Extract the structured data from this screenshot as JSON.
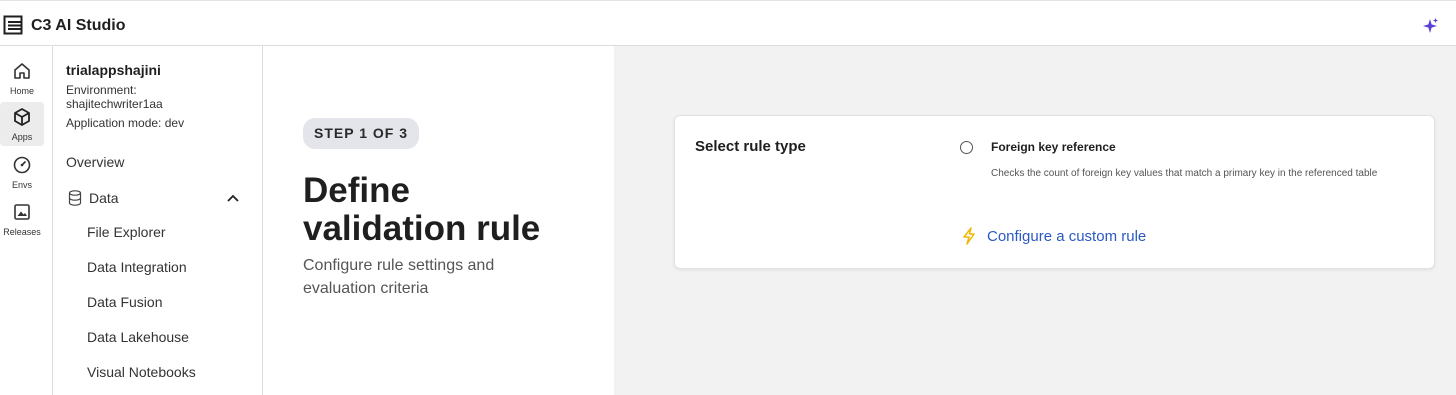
{
  "app": {
    "title": "C3 AI Studio",
    "logo_icon": "c3-logo-icon",
    "assistant_icon": "sparkle-icon"
  },
  "rail": {
    "items": [
      {
        "label": "Home",
        "icon": "home-icon",
        "active": false
      },
      {
        "label": "Apps",
        "icon": "cube-icon",
        "active": true
      },
      {
        "label": "Envs",
        "icon": "gauge-icon",
        "active": false
      },
      {
        "label": "Releases",
        "icon": "image-box-icon",
        "active": false
      }
    ]
  },
  "sidebar": {
    "tenant": "trialappshajini",
    "environment_label": "Environment:",
    "environment_value": "shajitechwriter1aa",
    "mode": "Application mode: dev",
    "overview": "Overview",
    "data_section": "Data",
    "data_items": [
      "File Explorer",
      "Data Integration",
      "Data Fusion",
      "Data Lakehouse",
      "Visual Notebooks"
    ]
  },
  "intro": {
    "step": "STEP 1 OF 3",
    "title_line1": "Define",
    "title_line2": "validation rule",
    "subtitle_line1": "Configure rule settings and",
    "subtitle_line2": "evaluation criteria"
  },
  "rule_card": {
    "title": "Select rule type",
    "option_title": "Foreign key reference",
    "option_desc": "Checks the count of foreign key values that match a primary key in the referenced table",
    "option_selected": false,
    "custom_link": "Configure a custom rule"
  },
  "colors": {
    "link": "#2b59c3",
    "bolt": "#f2b705",
    "sparkle": "#5b3fd6",
    "content_bg": "#f2f2f2"
  }
}
